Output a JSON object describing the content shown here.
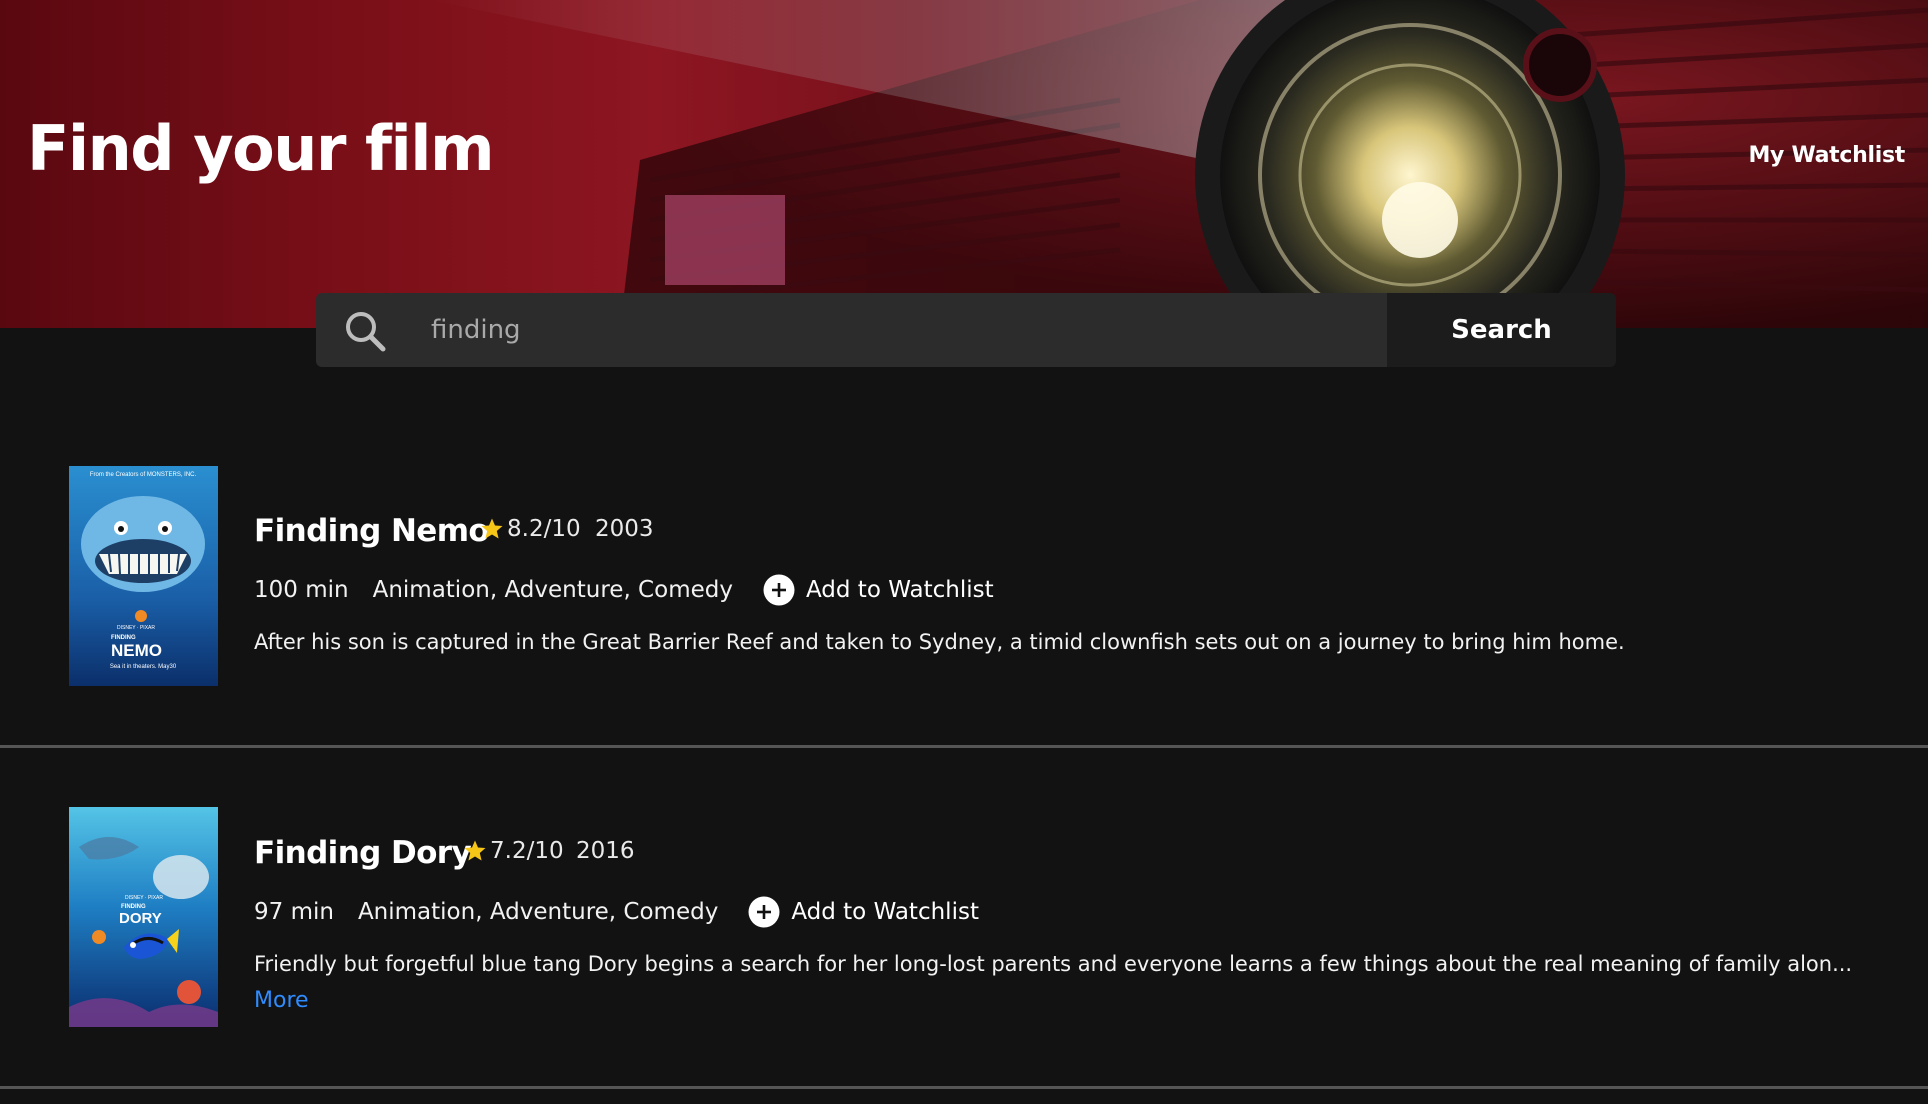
{
  "header": {
    "title": "Find your film",
    "watchlist_link": "My Watchlist"
  },
  "search": {
    "value": "finding",
    "button_label": "Search"
  },
  "results": [
    {
      "title": "Finding Nemo",
      "rating": "8.2/10",
      "year": "2003",
      "runtime": "100 min",
      "genres": "Animation, Adventure, Comedy",
      "watchlist_action": "Add to Watchlist",
      "plot": "After his son is captured in the Great Barrier Reef and taken to Sydney, a timid clownfish sets out on a journey to bring him home.",
      "poster": {
        "top_line": "From the Creators of MONSTERS, INC.",
        "brand": "DISNEY · PIXAR",
        "title_small": "FINDING",
        "title_large": "NEMO",
        "tagline": "Sea it in theaters. May30"
      }
    },
    {
      "title": "Finding Dory",
      "rating": "7.2/10",
      "year": "2016",
      "runtime": "97 min",
      "genres": "Animation, Adventure, Comedy",
      "watchlist_action": "Add to Watchlist",
      "plot": "Friendly but forgetful blue tang Dory begins a search for her long-lost parents and everyone learns a few things about the real meaning of family alon...",
      "more_link": "More",
      "poster": {
        "brand": "DISNEY · PIXAR",
        "title_small": "FINDING",
        "title_large": "DORY"
      }
    }
  ],
  "colors": {
    "background": "#121212",
    "search_field": "#2c2c2c",
    "search_button": "#1c1c1c",
    "star": "#f5c518",
    "link": "#2f8cff",
    "divider": "#555555"
  }
}
